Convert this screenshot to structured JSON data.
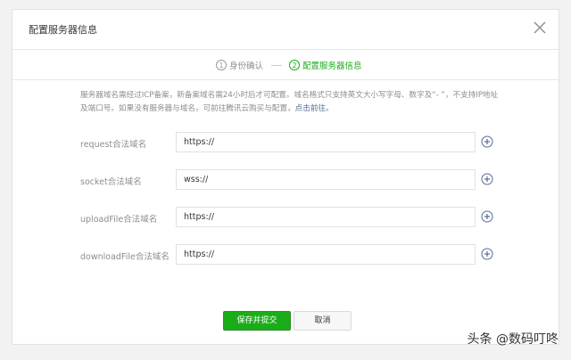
{
  "dialog": {
    "title": "配置服务器信息",
    "close_icon": "close-icon"
  },
  "steps": [
    {
      "num": "1",
      "label": "身份确认"
    },
    {
      "num": "2",
      "label": "配置服务器信息"
    }
  ],
  "notice": {
    "text": "服务器域名需经过ICP备案，新备案域名需24小时后才可配置。域名格式只支持英文大小写字母、数字及“- ”，不支持IP地址及端口号。如果没有服务器与域名，可前往腾讯云购买与配置，",
    "link": "点击前往。"
  },
  "fields": [
    {
      "label": "request合法域名",
      "value": "https://"
    },
    {
      "label": "socket合法域名",
      "value": "wss://"
    },
    {
      "label": "uploadFile合法域名",
      "value": "https://"
    },
    {
      "label": "downloadFile合法域名",
      "value": "https://"
    }
  ],
  "buttons": {
    "submit": "保存并提交",
    "cancel": "取消"
  },
  "watermark": "头条 @数码叮咚",
  "colors": {
    "accent": "#1aad19",
    "link": "#576b95"
  }
}
